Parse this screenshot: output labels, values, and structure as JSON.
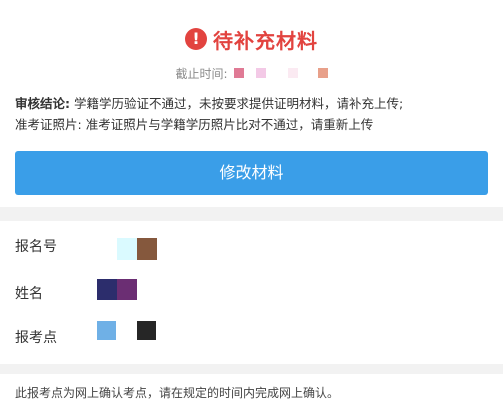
{
  "status": {
    "title": "待补充材料",
    "icon": "exclamation-circle-icon",
    "color": "#e2433f"
  },
  "deadline": {
    "label": "截止时间:"
  },
  "review": {
    "conclusion_label": "审核结论:",
    "conclusion_text": "学籍学历验证不通过，未按要求提供证明材料，请补充上传;",
    "photo_label": "准考证照片:",
    "photo_text": "准考证照片与学籍学历照片比对不通过，请重新上传"
  },
  "actions": {
    "edit_label": "修改材料",
    "accent": "#3a9ee8"
  },
  "info": {
    "registration_label": "报名号",
    "name_label": "姓名",
    "exam_site_label": "报考点"
  },
  "notice": "此报考点为网上确认考点，请在规定的时间内完成网上确认。"
}
